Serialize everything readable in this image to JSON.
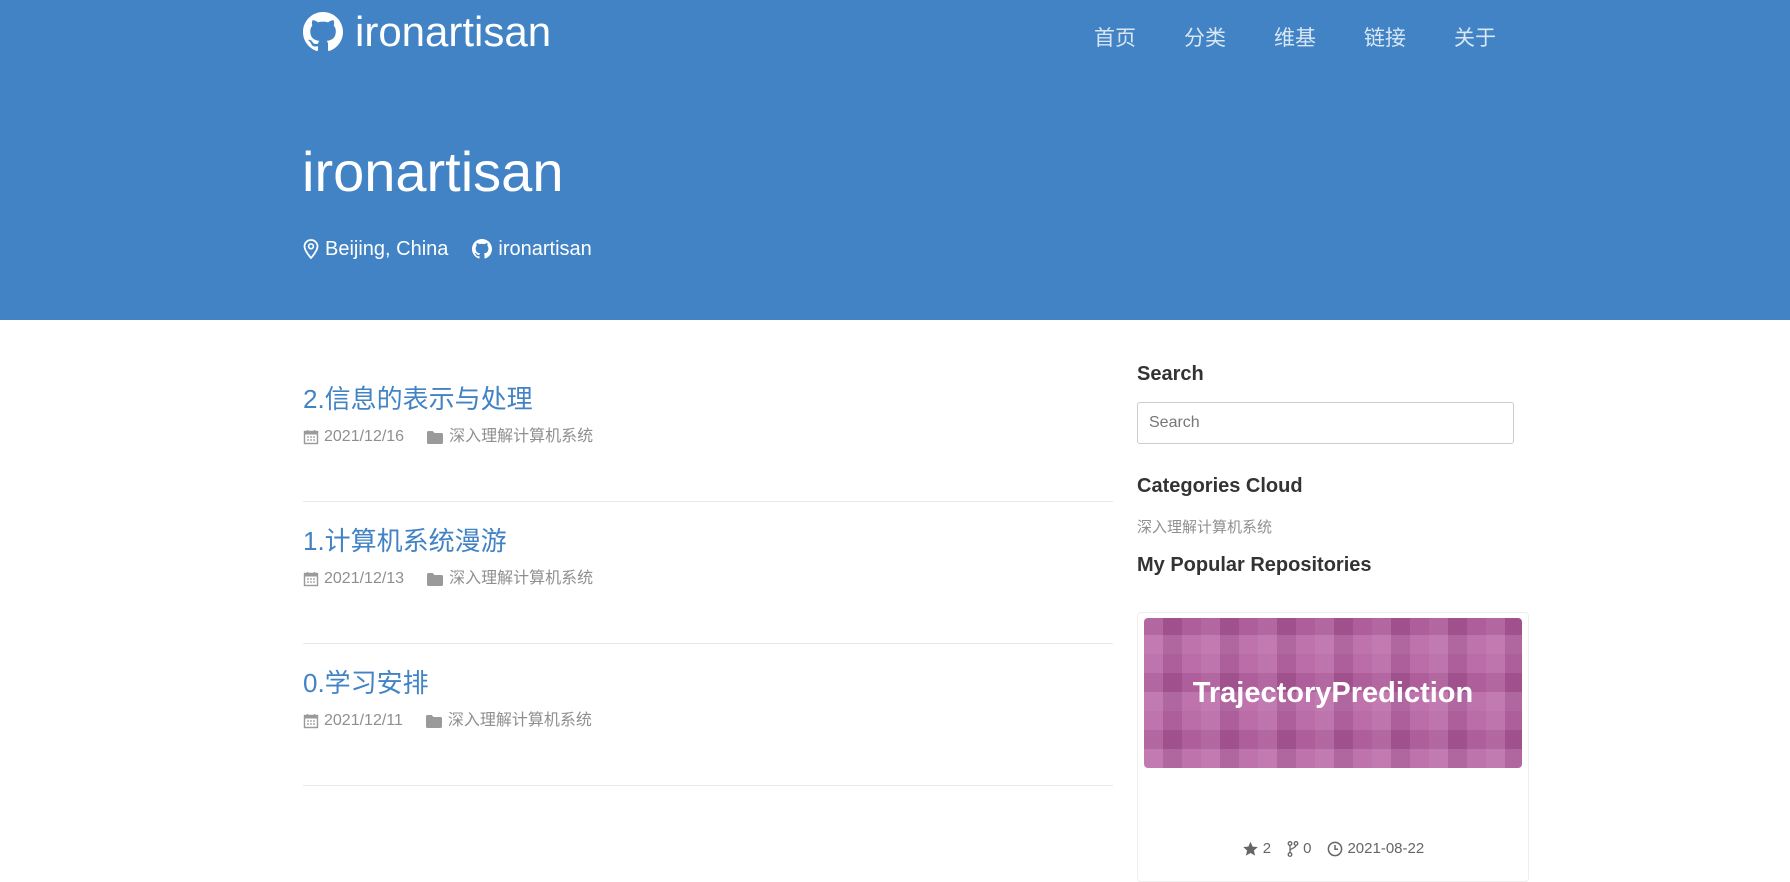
{
  "site": {
    "brand": "ironartisan",
    "nav": [
      "首页",
      "分类",
      "维基",
      "链接",
      "关于"
    ]
  },
  "hero": {
    "title": "ironartisan",
    "location": "Beijing, China",
    "github": "ironartisan"
  },
  "posts": [
    {
      "title": "2.信息的表示与处理",
      "date": "2021/12/16",
      "category": "深入理解计算机系统"
    },
    {
      "title": "1.计算机系统漫游",
      "date": "2021/12/13",
      "category": "深入理解计算机系统"
    },
    {
      "title": "0.学习安排",
      "date": "2021/12/11",
      "category": "深入理解计算机系统"
    }
  ],
  "sidebar": {
    "search_heading": "Search",
    "search_placeholder": "Search",
    "categories_heading": "Categories Cloud",
    "categories": [
      "深入理解计算机系统"
    ],
    "repos_heading": "My Popular Repositories",
    "repo": {
      "name": "TrajectoryPrediction",
      "stars": "2",
      "forks": "0",
      "updated": "2021-08-22",
      "banner_color": "#b35b9e"
    }
  },
  "icons": {
    "brand": "github-icon",
    "location": "map-pin-icon",
    "post_date": "calendar-icon",
    "post_category": "folder-icon",
    "stars": "star-icon",
    "forks": "fork-icon",
    "updated": "clock-icon"
  },
  "colors": {
    "header_bg": "#4183c4",
    "link": "#4183c4",
    "muted": "#8f8f8f"
  }
}
